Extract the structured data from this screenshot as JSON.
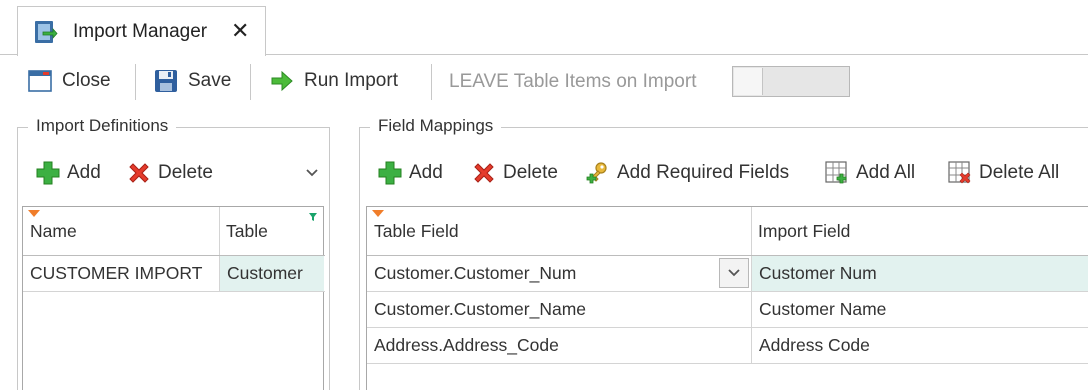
{
  "tab": {
    "title": "Import Manager",
    "close_glyph": "✕",
    "icon": "import-manager-icon"
  },
  "toolbar": {
    "close_label": "Close",
    "save_label": "Save",
    "run_import_label": "Run Import",
    "leave_items_label": "LEAVE Table Items on Import",
    "leave_items_on": false
  },
  "import_definitions": {
    "title": "Import Definitions",
    "add_label": "Add",
    "delete_label": "Delete",
    "columns": [
      "Name",
      "Table"
    ],
    "rows": [
      {
        "name": "CUSTOMER IMPORT",
        "table": "Customer"
      }
    ]
  },
  "field_mappings": {
    "title": "Field Mappings",
    "add_label": "Add",
    "delete_label": "Delete",
    "add_required_label": "Add Required Fields",
    "add_all_label": "Add All",
    "delete_all_label": "Delete All",
    "columns": [
      "Table Field",
      "Import Field"
    ],
    "rows": [
      {
        "table_field": "Customer.Customer_Num",
        "import_field": "Customer Num"
      },
      {
        "table_field": "Customer.Customer_Name",
        "import_field": "Customer Name"
      },
      {
        "table_field": "Address.Address_Code",
        "import_field": "Address Code"
      }
    ]
  },
  "colors": {
    "selected_cell": "#e2f2ef",
    "sort_indicator": "#f07d2a",
    "filter_indicator": "#19a36b",
    "add_green": "#3cb043",
    "delete_red": "#e53b2c"
  }
}
